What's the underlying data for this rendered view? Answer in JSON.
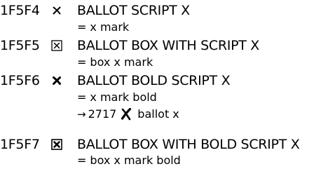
{
  "entries": [
    {
      "code": "1F5F4",
      "glyph_icon": "script-x-icon",
      "name": "BALLOT SCRIPT X",
      "alias_prefix": "=",
      "alias": "x mark"
    },
    {
      "code": "1F5F5",
      "glyph_icon": "box-x-icon",
      "name": "BALLOT BOX WITH SCRIPT X",
      "alias_prefix": "=",
      "alias": "box x mark"
    },
    {
      "code": "1F5F6",
      "glyph_icon": "bold-script-x-icon",
      "name": "BALLOT BOLD SCRIPT X",
      "alias_prefix": "=",
      "alias": "x mark bold",
      "xref": {
        "arrow": "→",
        "code": "2717",
        "glyph_icon": "heavy-ballot-x-icon",
        "name": "ballot x"
      }
    },
    {
      "code": "1F5F7",
      "glyph_icon": "box-bold-x-icon",
      "name": "BALLOT BOX WITH BOLD SCRIPT X",
      "alias_prefix": "=",
      "alias": "box x mark bold"
    }
  ]
}
